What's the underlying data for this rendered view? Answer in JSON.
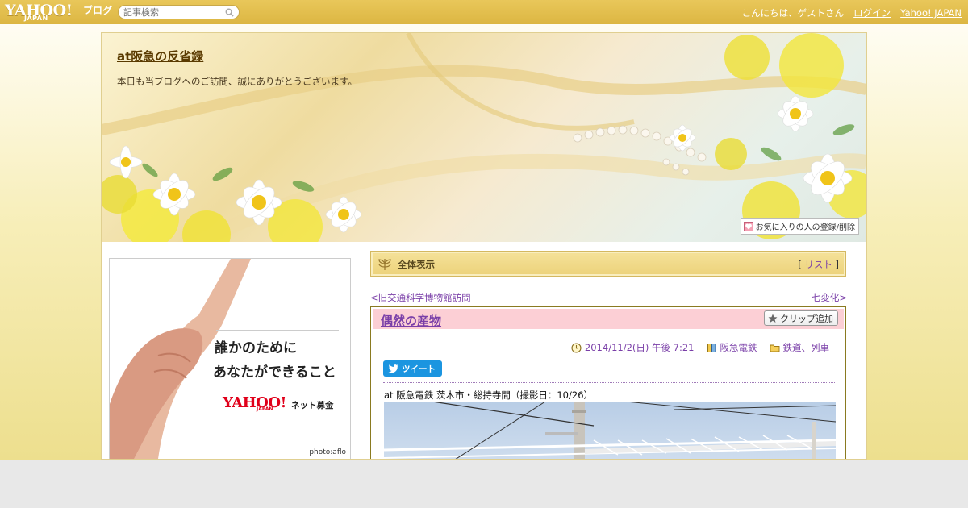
{
  "topbar": {
    "logo_text": "YAHOO!",
    "logo_sub": "JAPAN",
    "logo_blog": "ブログ",
    "search_placeholder": "記事検索",
    "greeting": "こんにちは、ゲストさん",
    "login": "ログイン",
    "yahoo_japan": "Yahoo! JAPAN"
  },
  "header": {
    "blog_title": "at阪急の反省録",
    "description": "本日も当ブログへのご訪問、誠にありがとうございます。",
    "favorite_button": "お気に入りの人の登録/削除"
  },
  "ad": {
    "line1": "誰かのために",
    "line2": "あなたができること",
    "logo": "YAHOO!",
    "logo_sub": "JAPAN",
    "service": "ネット募金",
    "credit": "photo:aflo"
  },
  "breadbar": {
    "label": "全体表示",
    "list_open": "[ ",
    "list_link": "リスト",
    "list_close": " ]"
  },
  "nav": {
    "prev_marker": "<",
    "prev_title": "旧交通科学博物館訪問",
    "next_title": "七変化",
    "next_marker": ">"
  },
  "entry": {
    "title": "偶然の産物",
    "clip_label": "クリップ追加",
    "date": "2014/11/2(日) 午後 7:21",
    "category1": "阪急電鉄",
    "category2": "鉄道、列車",
    "tweet_label": "ツイート",
    "caption": "at 阪急電鉄 茨木市・総持寺間（撮影日：10/26）"
  },
  "colors": {
    "topbar": "#dcb642",
    "link": "#7a3fa8",
    "entry_header": "#fccfd5",
    "tweet": "#1b95e0"
  }
}
